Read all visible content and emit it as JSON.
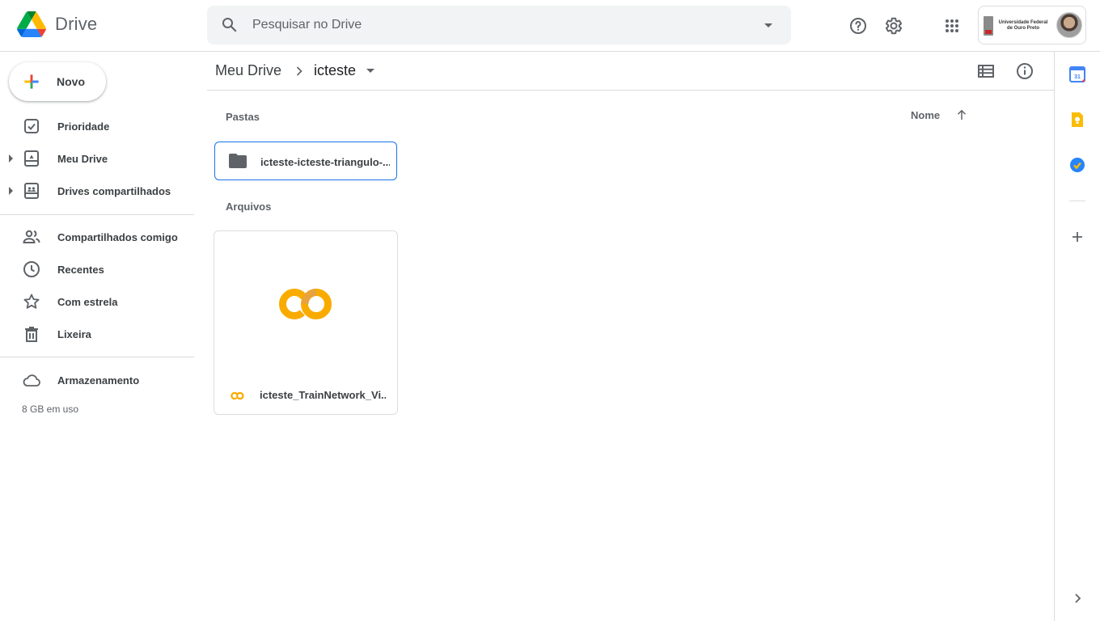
{
  "header": {
    "app_name": "Drive",
    "search_placeholder": "Pesquisar no Drive",
    "account_org_line1": "Universidade Federal",
    "account_org_line2": "de Ouro Preto"
  },
  "sidebar": {
    "new_label": "Novo",
    "items": [
      {
        "label": "Prioridade",
        "icon": "priority-check-icon"
      },
      {
        "label": "Meu Drive",
        "icon": "my-drive-icon"
      },
      {
        "label": "Drives compartilhados",
        "icon": "shared-drives-icon"
      },
      {
        "label": "Compartilhados comigo",
        "icon": "people-icon"
      },
      {
        "label": "Recentes",
        "icon": "clock-icon"
      },
      {
        "label": "Com estrela",
        "icon": "star-icon"
      },
      {
        "label": "Lixeira",
        "icon": "trash-icon"
      },
      {
        "label": "Armazenamento",
        "icon": "cloud-icon"
      }
    ],
    "storage_used": "8 GB em uso"
  },
  "breadcrumb": {
    "root": "Meu Drive",
    "current": "icteste"
  },
  "main": {
    "folders_label": "Pastas",
    "files_label": "Arquivos",
    "sort_label": "Nome",
    "folders": [
      {
        "name": "icteste-icteste-triangulo-..."
      }
    ],
    "files": [
      {
        "name": "icteste_TrainNetwork_Vi...",
        "type": "colab-notebook"
      }
    ]
  },
  "colors": {
    "accent": "#1a73e8",
    "colab_orange": "#F9AB00",
    "colab_yellow": "#E8710A"
  }
}
